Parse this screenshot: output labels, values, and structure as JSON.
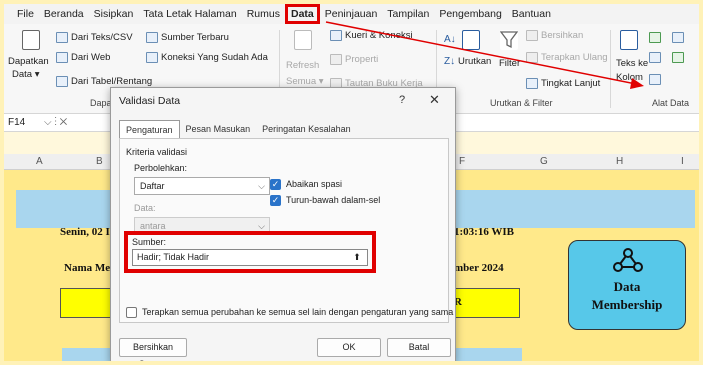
{
  "menu": [
    "File",
    "Beranda",
    "Sisipkan",
    "Tata Letak Halaman",
    "Rumus",
    "Data",
    "Peninjauan",
    "Tampilan",
    "Pengembang",
    "Bantuan"
  ],
  "ribbon": {
    "get_data": {
      "dapatkan": "Dapatkan",
      "data": "Data ▾",
      "from_text": "Dari Teks/CSV",
      "from_web": "Dari Web",
      "from_table": "Dari Tabel/Rentang",
      "recent": "Sumber Terbaru",
      "existing": "Koneksi Yang Sudah Ada",
      "group": "Dapat"
    },
    "queries": {
      "refresh": "Refresh",
      "all": "Semua ▾",
      "queries_conn": "Kueri & Koneksi",
      "properties": "Properti",
      "workbook_links": "Tautan Buku Kerja"
    },
    "sort": {
      "az": "A↓",
      "za": "Z↓",
      "sort": "Urutkan",
      "filter": "Filter",
      "clear": "Bersihkan",
      "reapply": "Terapkan Ulang",
      "advanced": "Tingkat Lanjut",
      "group": "Urutkan & Filter"
    },
    "tools": {
      "text_to": "Teks ke",
      "kolom": "Kolom",
      "group": "Alat Data"
    }
  },
  "formula_bar": {
    "name_box": "F14",
    "fx": "⌵  ⋮  ✕"
  },
  "columns": [
    "A",
    "B",
    "F",
    "G",
    "H",
    "I"
  ],
  "sheet": {
    "date_left": "Senin, 02 I",
    "time_right": "1:03:16 WIB",
    "name_left": "Nama Me",
    "month_right": "mber 2024",
    "r_right": "R",
    "badge_line1": "Data",
    "badge_line2": "Membership"
  },
  "dialog": {
    "title": "Validasi Data",
    "help": "?",
    "close": "✕",
    "tabs": [
      "Pengaturan",
      "Pesan Masukan",
      "Peringatan Kesalahan"
    ],
    "criteria_label": "Kriteria validasi",
    "allow_label": "Perbolehkan:",
    "allow_value": "Daftar",
    "data_label": "Data:",
    "data_value": "antara",
    "ignore_blank": "Abaikan spasi",
    "in_cell_dropdown": "Turun-bawah dalam-sel",
    "source_label": "Sumber:",
    "source_value": "Hadir; Tidak Hadir",
    "apply_all": "Terapkan semua perubahan ke semua sel lain dengan pengaturan yang sama",
    "clear_all": "Bersihkan Semua",
    "ok": "OK",
    "cancel": "Batal"
  },
  "colors": {
    "highlight": "#e00000",
    "sheet_yellow": "#ffe98a",
    "sky": "#a9d6ee",
    "badge": "#57c8e9",
    "checkbox": "#2a73c9"
  }
}
